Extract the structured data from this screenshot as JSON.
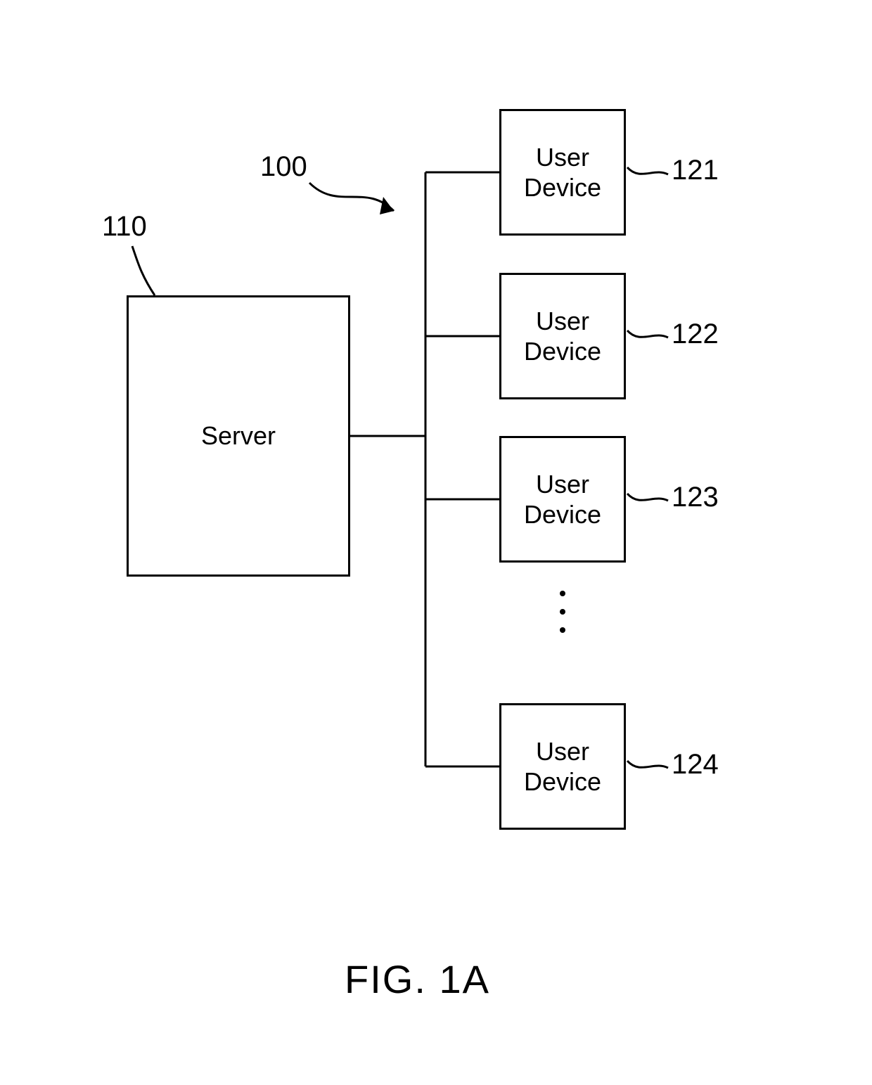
{
  "refs": {
    "system": "100",
    "server": "110",
    "device1": "121",
    "device2": "122",
    "device3": "123",
    "device4": "124"
  },
  "labels": {
    "server": "Server",
    "user_device": "User\nDevice"
  },
  "caption": "FIG. 1A"
}
